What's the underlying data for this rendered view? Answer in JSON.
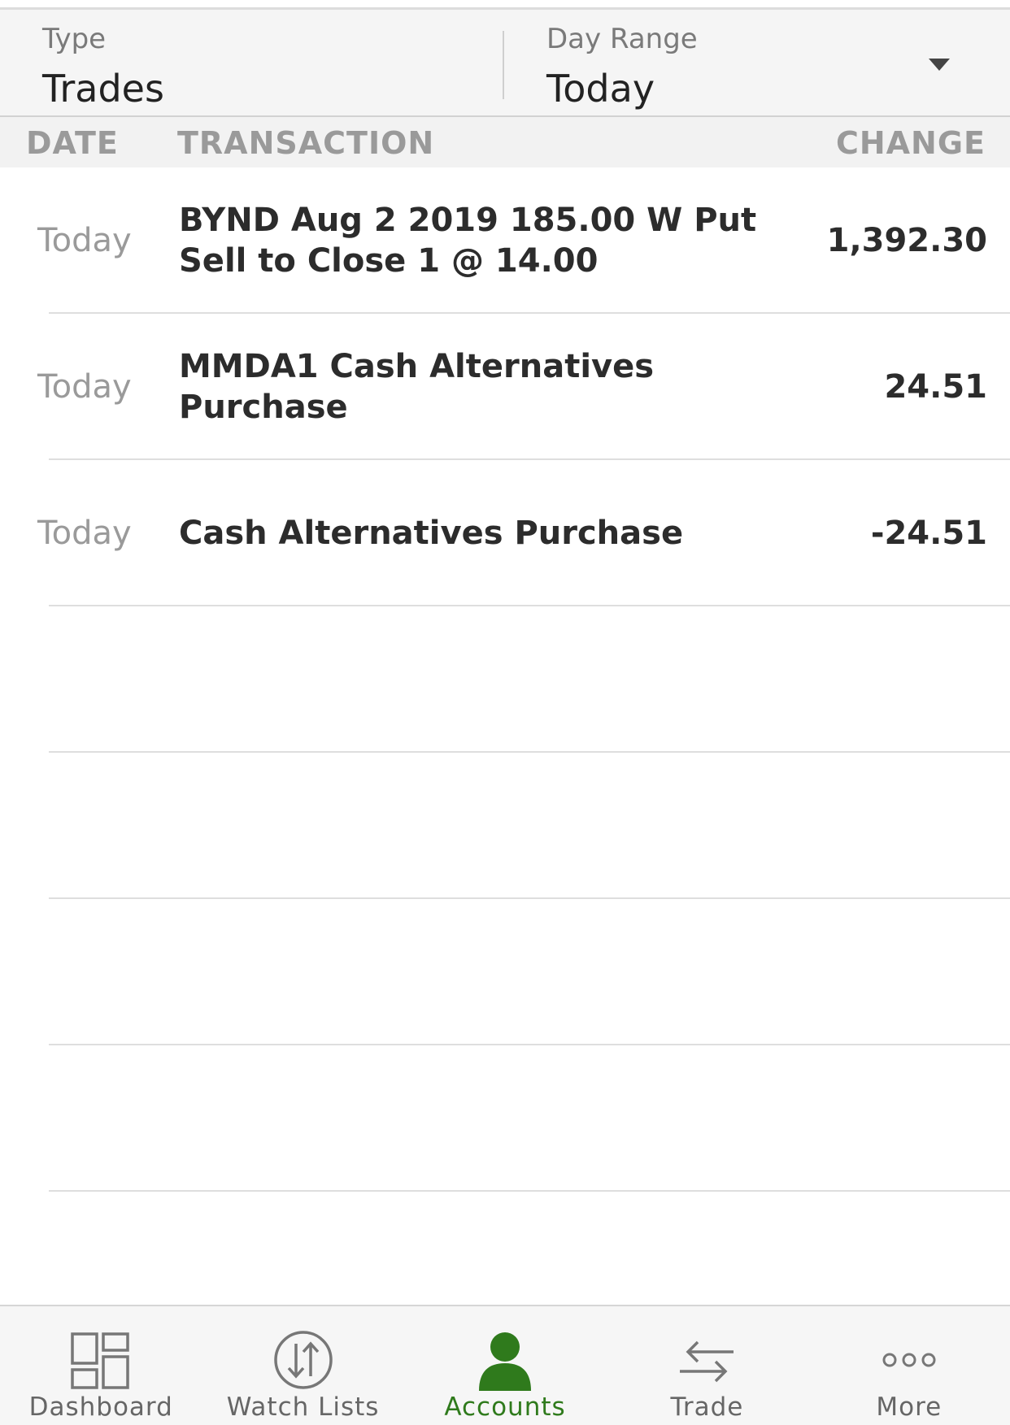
{
  "filters": {
    "type": {
      "label": "Type",
      "value": "Trades"
    },
    "day_range": {
      "label": "Day Range",
      "value": "Today",
      "icon": "dropdown-triangle-icon"
    }
  },
  "columns": {
    "date": "DATE",
    "transaction": "TRANSACTION",
    "change": "CHANGE"
  },
  "transactions": [
    {
      "date": "Today",
      "description": "BYND Aug 2 2019 185.00 W Put Sell to Close 1 @ 14.00",
      "change": "1,392.30"
    },
    {
      "date": "Today",
      "description": "MMDA1 Cash Alternatives Purchase",
      "change": "24.51"
    },
    {
      "date": "Today",
      "description": "Cash Alternatives Purchase",
      "change": "-24.51"
    },
    {
      "date": "",
      "description": "",
      "change": ""
    },
    {
      "date": "",
      "description": "",
      "change": ""
    },
    {
      "date": "",
      "description": "",
      "change": ""
    },
    {
      "date": "",
      "description": "",
      "change": ""
    }
  ],
  "tab_bar": {
    "active_color": "#2f7a1c",
    "inactive_color": "#666666",
    "tabs": [
      {
        "label": "Dashboard",
        "icon": "dashboard-grid-icon",
        "active": false
      },
      {
        "label": "Watch Lists",
        "icon": "up-down-arrows-circle-icon",
        "active": false
      },
      {
        "label": "Accounts",
        "icon": "person-icon",
        "active": true
      },
      {
        "label": "Trade",
        "icon": "swap-arrows-icon",
        "active": false
      },
      {
        "label": "More",
        "icon": "three-dots-icon",
        "active": false
      }
    ]
  }
}
